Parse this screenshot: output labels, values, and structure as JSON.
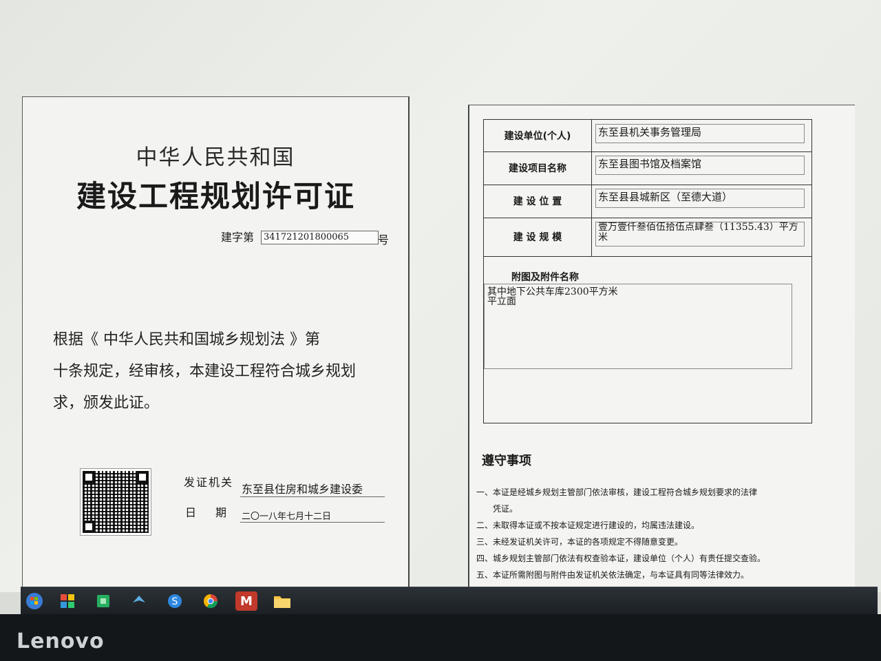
{
  "left_page": {
    "country": "中华人民共和国",
    "title": "建设工程规划许可证",
    "cert_no_label": "建字第",
    "cert_no": "341721201800065",
    "cert_no_suffix": "号",
    "body_lines": [
      "根据《 中华人民共和国城乡规划法 》第",
      "十条规定，经审核，本建设工程符合城乡规划",
      "求，颁发此证。"
    ],
    "issuer_label": "发证机关",
    "issuer": "东至县住房和城乡建设委",
    "date_label": "日期",
    "date": "二〇一八年七月十二日"
  },
  "right_page": {
    "rows": [
      {
        "label": "建设单位(个人)",
        "value": "东至县机关事务管理局"
      },
      {
        "label": "建设项目名称",
        "value": "东至县图书馆及档案馆"
      },
      {
        "label": "建 设 位 置",
        "value": "东至县县城新区（至德大道）"
      },
      {
        "label": "建 设 规 模",
        "value": "壹万壹仟叁佰伍拾伍点肆叁（11355.43）平方米"
      }
    ],
    "attach_label": "附图及附件名称",
    "attach_lines": [
      "其中地下公共车库2300平方米",
      "平立面"
    ],
    "notice_title": "遵守事项",
    "notices": [
      "一、本证是经城乡规划主管部门依法审核，建设工程符合城乡规划要求的法律",
      "　　凭证。",
      "二、未取得本证或不按本证规定进行建设的，均属违法建设。",
      "三、未经发证机关许可，本证的各项规定不得随意变更。",
      "四、城乡规划主管部门依法有权查验本证，建设单位（个人）有责任提交查验。",
      "五、本证所需附图与附件由发证机关依法确定，与本证具有同等法律效力。"
    ]
  },
  "taskbar": {
    "icons": [
      "start-icon",
      "color-app-icon",
      "green-app-icon",
      "bird-app-icon",
      "s-browser-icon",
      "chrome-icon",
      "mcafee-icon",
      "folder-icon"
    ],
    "mcafee_glyph": "M"
  },
  "bezel": {
    "brand": "Lenovo"
  }
}
